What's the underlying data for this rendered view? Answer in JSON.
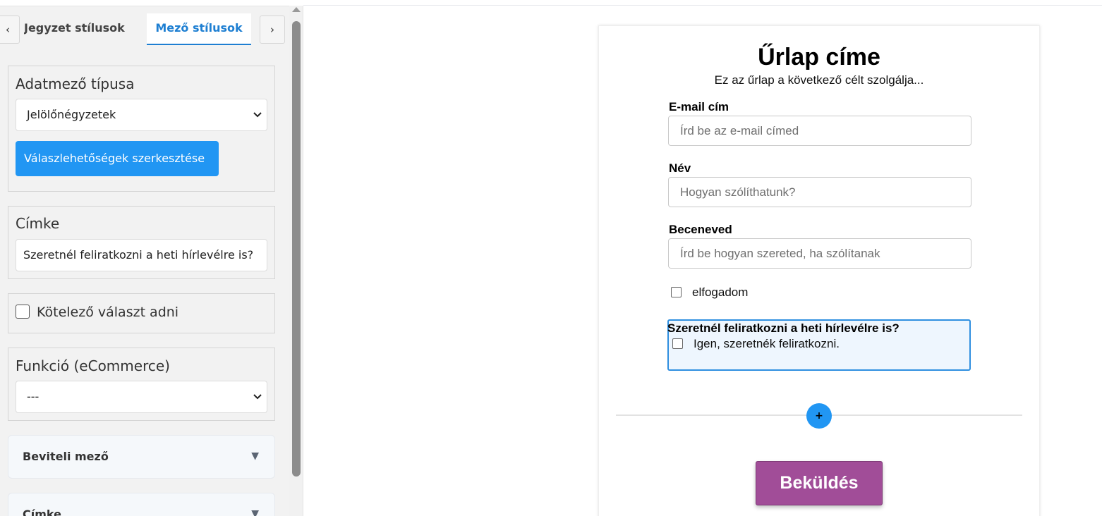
{
  "sidebar": {
    "tabs": {
      "left_arrow": "‹",
      "right_arrow": "›",
      "previous_tab": "Jegyzet stílusok",
      "active_tab": "Mező stílusok"
    },
    "field_type": {
      "title": "Adatmező típusa",
      "selected": "Jelölőnégyzetek",
      "edit_options_button": "Válaszlehetőségek szerkesztése"
    },
    "label_section": {
      "title": "Címke",
      "value": "Szeretnél feliratkozni a heti hírlevélre is?"
    },
    "required": {
      "label": "Kötelező választ adni",
      "checked": false
    },
    "function": {
      "title": "Funkció (eCommerce)",
      "selected": "---"
    },
    "accordions": [
      {
        "label": "Beviteli mező"
      },
      {
        "label": "Címke"
      }
    ]
  },
  "form": {
    "title": "Űrlap címe",
    "subtitle": "Ez az űrlap a következő célt szolgálja...",
    "fields": [
      {
        "label": "E-mail cím",
        "placeholder": "Írd be az e-mail címed"
      },
      {
        "label": "Név",
        "placeholder": "Hogyan szólíthatunk?"
      },
      {
        "label": "Beceneved",
        "placeholder": "Írd be hogyan szereted, ha szólítanak"
      }
    ],
    "accept_checkbox": {
      "label": "elfogadom",
      "checked": false
    },
    "selected_field": {
      "label": "Szeretnél feliratkozni a heti hírlevélre is?",
      "option": "Igen, szeretnék feliratkozni.",
      "checked": false
    },
    "add_button": "+",
    "submit_button": "Beküldés"
  },
  "colors": {
    "accent_blue": "#2196f3",
    "active_tab_blue": "#1e7fd2",
    "submit_purple": "#a14d98",
    "selection_border": "#2f8fe0"
  }
}
